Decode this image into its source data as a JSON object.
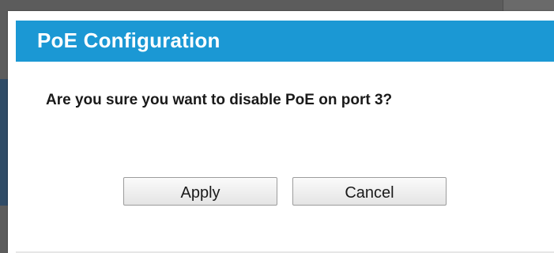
{
  "dialog": {
    "title": "PoE Configuration",
    "message": "Are you sure you want to disable PoE on port 3?",
    "apply_label": "Apply",
    "cancel_label": "Cancel",
    "header_color": "#1b98d4"
  }
}
